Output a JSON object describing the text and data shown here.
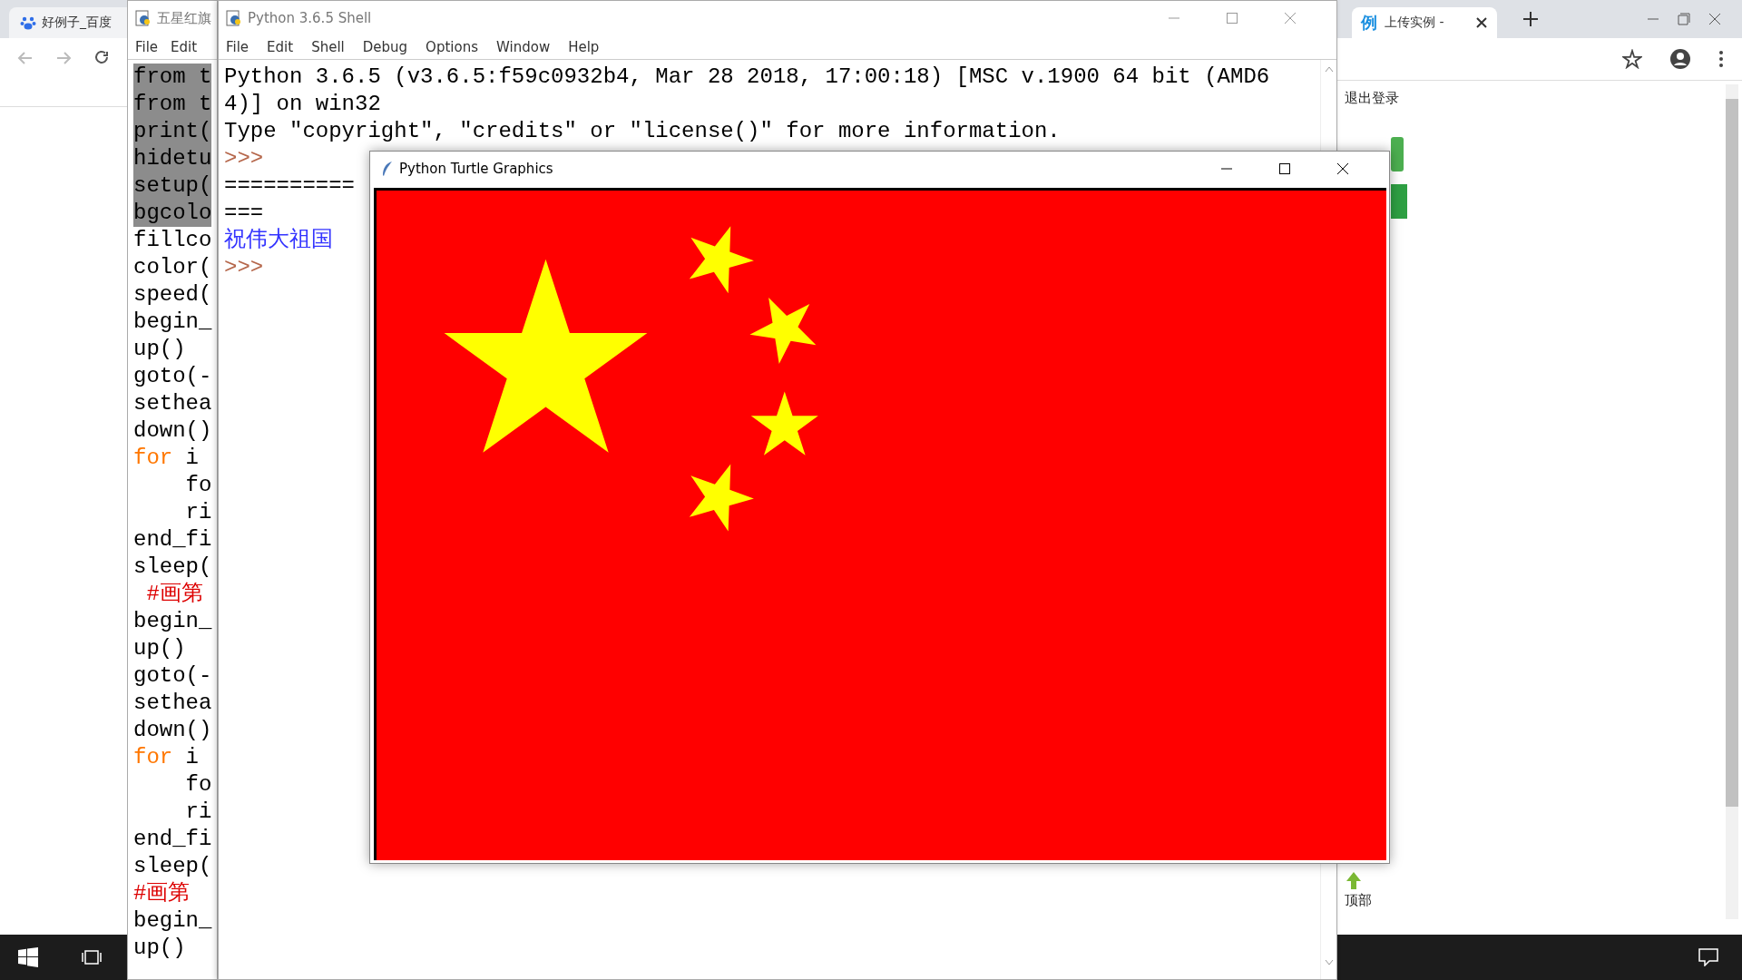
{
  "left_browser": {
    "tab": {
      "title": "好例子_百度"
    }
  },
  "editor": {
    "title": "五星红旗",
    "menu": [
      "File",
      "Edit"
    ],
    "lines": [
      {
        "selected": true,
        "parts": [
          {
            "text": "from t",
            "kind": "plain"
          }
        ]
      },
      {
        "selected": true,
        "parts": [
          {
            "text": "from t",
            "kind": "plain"
          }
        ]
      },
      {
        "selected": true,
        "parts": [
          {
            "text": "print(",
            "kind": "plain"
          }
        ]
      },
      {
        "selected": true,
        "parts": [
          {
            "text": "hidetu",
            "kind": "plain"
          }
        ]
      },
      {
        "selected": true,
        "parts": [
          {
            "text": "setup(",
            "kind": "plain"
          }
        ]
      },
      {
        "selected": true,
        "parts": [
          {
            "text": "bgcolo",
            "kind": "plain"
          }
        ]
      },
      {
        "selected": false,
        "parts": [
          {
            "text": "fillco",
            "kind": "plain"
          }
        ]
      },
      {
        "selected": false,
        "parts": [
          {
            "text": "color(",
            "kind": "plain"
          }
        ]
      },
      {
        "selected": false,
        "parts": [
          {
            "text": "speed(",
            "kind": "plain"
          }
        ]
      },
      {
        "selected": false,
        "parts": [
          {
            "text": "begin_",
            "kind": "plain"
          }
        ]
      },
      {
        "selected": false,
        "parts": [
          {
            "text": "up()",
            "kind": "plain"
          }
        ]
      },
      {
        "selected": false,
        "parts": [
          {
            "text": "goto(-",
            "kind": "plain"
          }
        ]
      },
      {
        "selected": false,
        "parts": [
          {
            "text": "sethea",
            "kind": "plain"
          }
        ]
      },
      {
        "selected": false,
        "parts": [
          {
            "text": "down()",
            "kind": "plain"
          }
        ]
      },
      {
        "selected": false,
        "parts": [
          {
            "text": "for",
            "kind": "keyword"
          },
          {
            "text": " i",
            "kind": "plain"
          }
        ]
      },
      {
        "selected": false,
        "parts": [
          {
            "text": "    fo",
            "kind": "plain"
          }
        ]
      },
      {
        "selected": false,
        "parts": [
          {
            "text": "    ri",
            "kind": "plain"
          }
        ]
      },
      {
        "selected": false,
        "parts": [
          {
            "text": "end_fi",
            "kind": "plain"
          }
        ]
      },
      {
        "selected": false,
        "parts": [
          {
            "text": "sleep(",
            "kind": "plain"
          }
        ]
      },
      {
        "selected": false,
        "parts": [
          {
            "text": " #画第",
            "kind": "comment"
          }
        ]
      },
      {
        "selected": false,
        "parts": [
          {
            "text": "begin_",
            "kind": "plain"
          }
        ]
      },
      {
        "selected": false,
        "parts": [
          {
            "text": "up()",
            "kind": "plain"
          }
        ]
      },
      {
        "selected": false,
        "parts": [
          {
            "text": "goto(-",
            "kind": "plain"
          }
        ]
      },
      {
        "selected": false,
        "parts": [
          {
            "text": "sethea",
            "kind": "plain"
          }
        ]
      },
      {
        "selected": false,
        "parts": [
          {
            "text": "down()",
            "kind": "plain"
          }
        ]
      },
      {
        "selected": false,
        "parts": [
          {
            "text": "for",
            "kind": "keyword"
          },
          {
            "text": " i",
            "kind": "plain"
          }
        ]
      },
      {
        "selected": false,
        "parts": [
          {
            "text": "    fo",
            "kind": "plain"
          }
        ]
      },
      {
        "selected": false,
        "parts": [
          {
            "text": "    ri",
            "kind": "plain"
          }
        ]
      },
      {
        "selected": false,
        "parts": [
          {
            "text": "end_fi",
            "kind": "plain"
          }
        ]
      },
      {
        "selected": false,
        "parts": [
          {
            "text": "sleep(",
            "kind": "plain"
          }
        ]
      },
      {
        "selected": false,
        "parts": [
          {
            "text": "#画第",
            "kind": "comment"
          }
        ]
      },
      {
        "selected": false,
        "parts": [
          {
            "text": "begin_",
            "kind": "plain"
          }
        ]
      },
      {
        "selected": false,
        "parts": [
          {
            "text": "up()",
            "kind": "plain"
          }
        ]
      }
    ]
  },
  "shell": {
    "title": "Python 3.6.5 Shell",
    "menu": [
      "File",
      "Edit",
      "Shell",
      "Debug",
      "Options",
      "Window",
      "Help"
    ],
    "lines": [
      {
        "kind": "output",
        "text": "Python 3.6.5 (v3.6.5:f59c0932b4, Mar 28 2018, 17:00:18) [MSC v.1900 64 bit (AMD6"
      },
      {
        "kind": "output",
        "text": "4)] on win32"
      },
      {
        "kind": "output",
        "text": "Type \"copyright\", \"credits\" or \"license()\" for more information."
      },
      {
        "kind": "prompt",
        "text": ">>>"
      },
      {
        "kind": "output",
        "text": "=========="
      },
      {
        "kind": "output",
        "text": "==="
      },
      {
        "kind": "message",
        "text": "祝伟大祖国"
      },
      {
        "kind": "prompt",
        "text": ">>>"
      }
    ]
  },
  "turtle": {
    "title": "Python Turtle Graphics"
  },
  "right_browser": {
    "tab": {
      "favicon": "例",
      "title": "上传实例 -",
      "selected": true
    },
    "logout_link": "退出登录",
    "back_to_top": "顶部"
  }
}
